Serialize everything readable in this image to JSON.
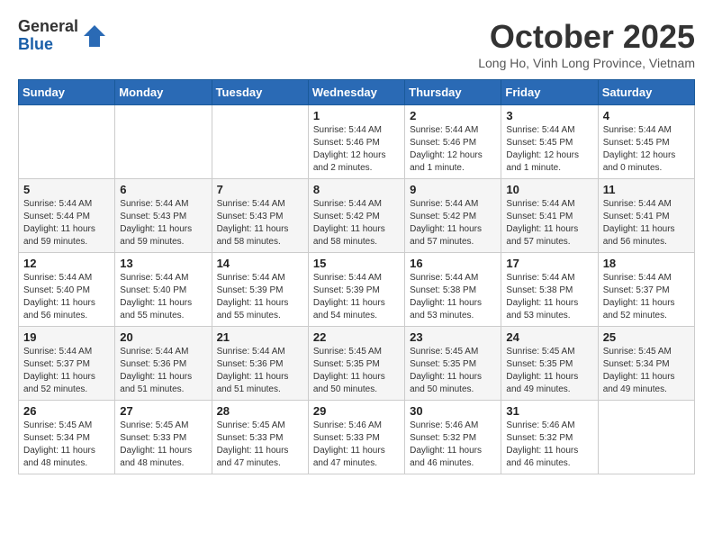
{
  "logo": {
    "general": "General",
    "blue": "Blue"
  },
  "title": "October 2025",
  "location": "Long Ho, Vinh Long Province, Vietnam",
  "days_header": [
    "Sunday",
    "Monday",
    "Tuesday",
    "Wednesday",
    "Thursday",
    "Friday",
    "Saturday"
  ],
  "weeks": [
    [
      {
        "day": "",
        "sunrise": "",
        "sunset": "",
        "daylight": ""
      },
      {
        "day": "",
        "sunrise": "",
        "sunset": "",
        "daylight": ""
      },
      {
        "day": "",
        "sunrise": "",
        "sunset": "",
        "daylight": ""
      },
      {
        "day": "1",
        "sunrise": "Sunrise: 5:44 AM",
        "sunset": "Sunset: 5:46 PM",
        "daylight": "Daylight: 12 hours and 2 minutes."
      },
      {
        "day": "2",
        "sunrise": "Sunrise: 5:44 AM",
        "sunset": "Sunset: 5:46 PM",
        "daylight": "Daylight: 12 hours and 1 minute."
      },
      {
        "day": "3",
        "sunrise": "Sunrise: 5:44 AM",
        "sunset": "Sunset: 5:45 PM",
        "daylight": "Daylight: 12 hours and 1 minute."
      },
      {
        "day": "4",
        "sunrise": "Sunrise: 5:44 AM",
        "sunset": "Sunset: 5:45 PM",
        "daylight": "Daylight: 12 hours and 0 minutes."
      }
    ],
    [
      {
        "day": "5",
        "sunrise": "Sunrise: 5:44 AM",
        "sunset": "Sunset: 5:44 PM",
        "daylight": "Daylight: 11 hours and 59 minutes."
      },
      {
        "day": "6",
        "sunrise": "Sunrise: 5:44 AM",
        "sunset": "Sunset: 5:43 PM",
        "daylight": "Daylight: 11 hours and 59 minutes."
      },
      {
        "day": "7",
        "sunrise": "Sunrise: 5:44 AM",
        "sunset": "Sunset: 5:43 PM",
        "daylight": "Daylight: 11 hours and 58 minutes."
      },
      {
        "day": "8",
        "sunrise": "Sunrise: 5:44 AM",
        "sunset": "Sunset: 5:42 PM",
        "daylight": "Daylight: 11 hours and 58 minutes."
      },
      {
        "day": "9",
        "sunrise": "Sunrise: 5:44 AM",
        "sunset": "Sunset: 5:42 PM",
        "daylight": "Daylight: 11 hours and 57 minutes."
      },
      {
        "day": "10",
        "sunrise": "Sunrise: 5:44 AM",
        "sunset": "Sunset: 5:41 PM",
        "daylight": "Daylight: 11 hours and 57 minutes."
      },
      {
        "day": "11",
        "sunrise": "Sunrise: 5:44 AM",
        "sunset": "Sunset: 5:41 PM",
        "daylight": "Daylight: 11 hours and 56 minutes."
      }
    ],
    [
      {
        "day": "12",
        "sunrise": "Sunrise: 5:44 AM",
        "sunset": "Sunset: 5:40 PM",
        "daylight": "Daylight: 11 hours and 56 minutes."
      },
      {
        "day": "13",
        "sunrise": "Sunrise: 5:44 AM",
        "sunset": "Sunset: 5:40 PM",
        "daylight": "Daylight: 11 hours and 55 minutes."
      },
      {
        "day": "14",
        "sunrise": "Sunrise: 5:44 AM",
        "sunset": "Sunset: 5:39 PM",
        "daylight": "Daylight: 11 hours and 55 minutes."
      },
      {
        "day": "15",
        "sunrise": "Sunrise: 5:44 AM",
        "sunset": "Sunset: 5:39 PM",
        "daylight": "Daylight: 11 hours and 54 minutes."
      },
      {
        "day": "16",
        "sunrise": "Sunrise: 5:44 AM",
        "sunset": "Sunset: 5:38 PM",
        "daylight": "Daylight: 11 hours and 53 minutes."
      },
      {
        "day": "17",
        "sunrise": "Sunrise: 5:44 AM",
        "sunset": "Sunset: 5:38 PM",
        "daylight": "Daylight: 11 hours and 53 minutes."
      },
      {
        "day": "18",
        "sunrise": "Sunrise: 5:44 AM",
        "sunset": "Sunset: 5:37 PM",
        "daylight": "Daylight: 11 hours and 52 minutes."
      }
    ],
    [
      {
        "day": "19",
        "sunrise": "Sunrise: 5:44 AM",
        "sunset": "Sunset: 5:37 PM",
        "daylight": "Daylight: 11 hours and 52 minutes."
      },
      {
        "day": "20",
        "sunrise": "Sunrise: 5:44 AM",
        "sunset": "Sunset: 5:36 PM",
        "daylight": "Daylight: 11 hours and 51 minutes."
      },
      {
        "day": "21",
        "sunrise": "Sunrise: 5:44 AM",
        "sunset": "Sunset: 5:36 PM",
        "daylight": "Daylight: 11 hours and 51 minutes."
      },
      {
        "day": "22",
        "sunrise": "Sunrise: 5:45 AM",
        "sunset": "Sunset: 5:35 PM",
        "daylight": "Daylight: 11 hours and 50 minutes."
      },
      {
        "day": "23",
        "sunrise": "Sunrise: 5:45 AM",
        "sunset": "Sunset: 5:35 PM",
        "daylight": "Daylight: 11 hours and 50 minutes."
      },
      {
        "day": "24",
        "sunrise": "Sunrise: 5:45 AM",
        "sunset": "Sunset: 5:35 PM",
        "daylight": "Daylight: 11 hours and 49 minutes."
      },
      {
        "day": "25",
        "sunrise": "Sunrise: 5:45 AM",
        "sunset": "Sunset: 5:34 PM",
        "daylight": "Daylight: 11 hours and 49 minutes."
      }
    ],
    [
      {
        "day": "26",
        "sunrise": "Sunrise: 5:45 AM",
        "sunset": "Sunset: 5:34 PM",
        "daylight": "Daylight: 11 hours and 48 minutes."
      },
      {
        "day": "27",
        "sunrise": "Sunrise: 5:45 AM",
        "sunset": "Sunset: 5:33 PM",
        "daylight": "Daylight: 11 hours and 48 minutes."
      },
      {
        "day": "28",
        "sunrise": "Sunrise: 5:45 AM",
        "sunset": "Sunset: 5:33 PM",
        "daylight": "Daylight: 11 hours and 47 minutes."
      },
      {
        "day": "29",
        "sunrise": "Sunrise: 5:46 AM",
        "sunset": "Sunset: 5:33 PM",
        "daylight": "Daylight: 11 hours and 47 minutes."
      },
      {
        "day": "30",
        "sunrise": "Sunrise: 5:46 AM",
        "sunset": "Sunset: 5:32 PM",
        "daylight": "Daylight: 11 hours and 46 minutes."
      },
      {
        "day": "31",
        "sunrise": "Sunrise: 5:46 AM",
        "sunset": "Sunset: 5:32 PM",
        "daylight": "Daylight: 11 hours and 46 minutes."
      },
      {
        "day": "",
        "sunrise": "",
        "sunset": "",
        "daylight": ""
      }
    ]
  ]
}
